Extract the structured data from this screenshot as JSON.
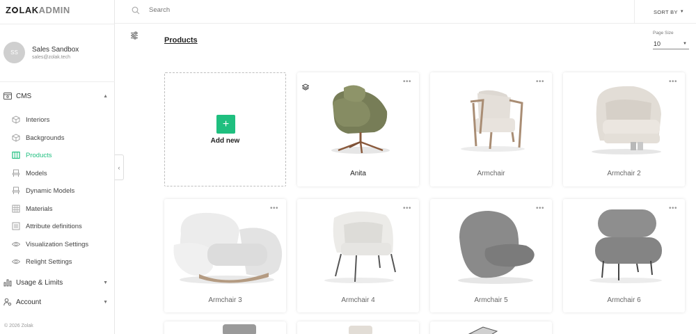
{
  "logo": {
    "z": "Z",
    "mark": "O",
    "rest": "LAK",
    "admin": "ADMIN"
  },
  "user": {
    "initials": "SS",
    "name": "Sales Sandbox",
    "email": "sales@zolak.tech"
  },
  "sidebar": {
    "cms_label": "CMS",
    "items": [
      {
        "label": "Interiors",
        "icon": "cube-icon"
      },
      {
        "label": "Backgrounds",
        "icon": "cube-outline-icon"
      },
      {
        "label": "Products",
        "icon": "products-icon",
        "active": true
      },
      {
        "label": "Models",
        "icon": "chair-icon"
      },
      {
        "label": "Dynamic Models",
        "icon": "chair-dynamic-icon"
      },
      {
        "label": "Materials",
        "icon": "grid-icon"
      },
      {
        "label": "Attribute definitions",
        "icon": "list-icon"
      },
      {
        "label": "Visualization Settings",
        "icon": "eye-icon"
      },
      {
        "label": "Relight Settings",
        "icon": "eye-settings-icon"
      }
    ],
    "usage_label": "Usage & Limits",
    "account_label": "Account",
    "copyright": "© 2026 Zolak"
  },
  "topbar": {
    "search_placeholder": "Search",
    "sort_label": "SORT BY"
  },
  "main": {
    "title": "Products",
    "page_size_label": "Page Size",
    "page_size_value": "10",
    "add_new_label": "Add new"
  },
  "products": [
    {
      "name": "Anita"
    },
    {
      "name": "Armchair"
    },
    {
      "name": "Armchair 2"
    },
    {
      "name": "Armchair 3"
    },
    {
      "name": "Armchair 4"
    },
    {
      "name": "Armchair 5"
    },
    {
      "name": "Armchair 6"
    }
  ],
  "colors": {
    "accent": "#1fbf7f",
    "text": "#333333",
    "muted": "#8e8e8e"
  }
}
